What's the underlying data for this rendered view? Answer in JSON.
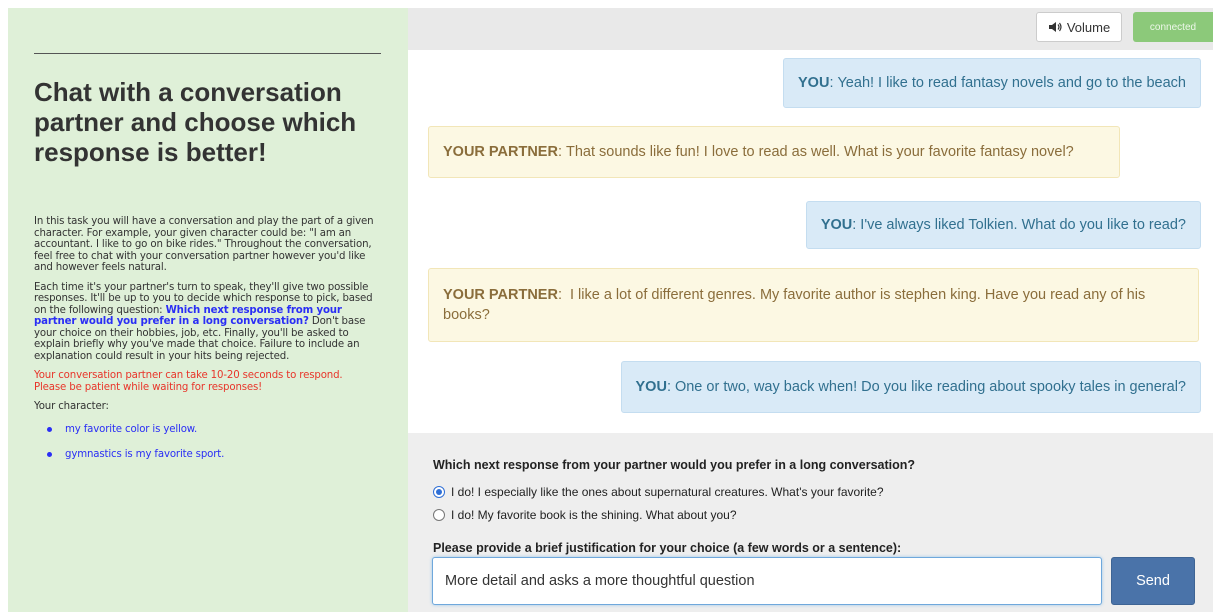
{
  "instructions": {
    "title": "Chat with a conversation partner and choose which response is better!",
    "p1": "In this task you will have a conversation and play the part of a given character. For example, your given character could be: \"I am an accountant. I like to go on bike rides.\" Throughout the conversation, feel free to chat with your conversation partner however you'd like and however feels natural.",
    "p2_before": "Each time it's your partner's turn to speak, they'll give two possible responses. It'll be up to you to decide which response to pick, based on the following question: ",
    "p2_question": "Which next response from your partner would you prefer in a long conversation?",
    "p2_after": " Don't base your choice on their hobbies, job, etc. Finally, you'll be asked to explain briefly why you've made that choice. Failure to include an explanation could result in your hits being rejected.",
    "warning": "Your conversation partner can take 10-20 seconds to respond. Please be patient while waiting for responses!",
    "character_label": "Your character:",
    "character_items": [
      "my favorite color is yellow.",
      "gymnastics is my favorite sport."
    ]
  },
  "topbar": {
    "volume_label": "Volume",
    "status": "connected"
  },
  "messages": [
    {
      "speaker": "YOU",
      "text": "Yeah! I like to read fantasy novels and go to the beach"
    },
    {
      "speaker": "YOUR PARTNER",
      "text": "That sounds like fun! I love to read as well. What is your favorite fantasy novel?"
    },
    {
      "speaker": "YOU",
      "text": "I've always liked Tolkien. What do you like to read?"
    },
    {
      "speaker": "YOUR PARTNER",
      "text": "I like a lot of different genres. My favorite author is stephen king. Have you read any of his books?"
    },
    {
      "speaker": "YOU",
      "text": "One or two, way back when! Do you like reading about spooky tales in general?"
    }
  ],
  "response_form": {
    "question": "Which next response from your partner would you prefer in a long conversation?",
    "options": [
      {
        "text": "I do! I especially like the ones about supernatural creatures. What's your favorite?",
        "selected": true
      },
      {
        "text": "I do! My favorite book is the shining. What about you?",
        "selected": false
      }
    ],
    "justification_label": "Please provide a brief justification for your choice (a few words or a sentence):",
    "justification_value": "More detail and asks a more thoughtful question",
    "send_label": "Send"
  },
  "colors": {
    "left_panel_bg": "#dff0d8",
    "you_bubble_bg": "#d9eaf7",
    "partner_bubble_bg": "#fcf8e3",
    "send_button_bg": "#4a73a9",
    "connected_bg": "#8cc97a",
    "highlight_blue": "#2a2ef5",
    "warning_red": "#e8352a"
  }
}
